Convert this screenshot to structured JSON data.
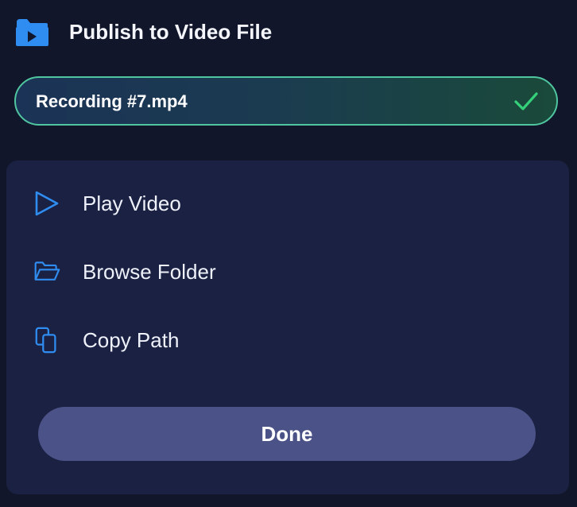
{
  "header": {
    "title": "Publish to Video File",
    "icon": "folder-video-icon"
  },
  "file": {
    "name": "Recording #7.mp4",
    "status_icon": "check-icon"
  },
  "menu": {
    "items": [
      {
        "label": "Play Video",
        "icon": "play-icon"
      },
      {
        "label": "Browse Folder",
        "icon": "folder-open-icon"
      },
      {
        "label": "Copy Path",
        "icon": "copy-icon"
      }
    ]
  },
  "actions": {
    "done_label": "Done"
  },
  "colors": {
    "background": "#11162a",
    "panel": "#1b2142",
    "accent_blue": "#2f8cf0",
    "success_green": "#34d17a",
    "button": "#4b5287"
  }
}
